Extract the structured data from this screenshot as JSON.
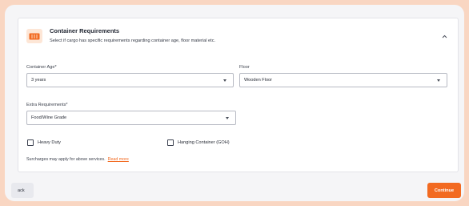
{
  "section": {
    "title": "Container Requirements",
    "subtitle": "Select if cargo has specific requirements regarding container age, floor material etc."
  },
  "fields": {
    "container_age": {
      "label": "Container Age*",
      "value": "3 years"
    },
    "floor": {
      "label": "Floor",
      "value": "Wooden Floor"
    },
    "extra_requirements": {
      "label": "Extra Requirements*",
      "value": "Food/Wine Grade"
    }
  },
  "checkboxes": {
    "heavy_duty": {
      "label": "Heavy Duty",
      "checked": false
    },
    "hanging_container": {
      "label": "Hanging Container (GOH)",
      "checked": false
    }
  },
  "note": {
    "text": "Surcharges may apply for above services.",
    "link": "Read more"
  },
  "buttons": {
    "back": "ack",
    "continue": "Continue"
  },
  "colors": {
    "accent": "#f26a21",
    "background": "#f9d6c2"
  },
  "icons": {
    "section": "container-icon",
    "collapse": "chevron-up-icon"
  }
}
